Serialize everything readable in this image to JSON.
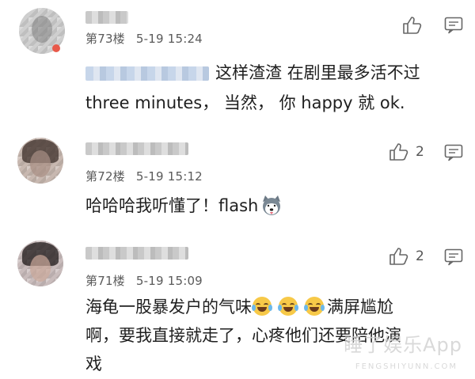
{
  "comments": [
    {
      "floor": "第73楼",
      "time": "5-19 15:24",
      "lines": [
        "这样渣渣 在剧里最多活不过",
        "three minutes， 当然， 你 happy 就 ok."
      ],
      "like_count": ""
    },
    {
      "floor": "第72楼",
      "time": "5-19 15:12",
      "lines": [
        "哈哈哈我听懂了！flash"
      ],
      "like_count": "2"
    },
    {
      "floor": "第71楼",
      "time": "5-19 15:09",
      "lines": [
        "海龟一股暴发户的气味",
        "满屏尴尬",
        "啊，要我直接就走了，心疼他们还要陪他演",
        "戏"
      ],
      "like_count": "2"
    }
  ],
  "watermark": {
    "main": "睡了娱乐App",
    "sub": "FENGSHIYUNN.COM"
  },
  "icons": {
    "like": "thumbs-up-icon",
    "reply": "comment-icon",
    "laugh": "tears-of-joy-emoji",
    "dog": "husky-emoji"
  },
  "colors": {
    "meta_text": "#5a5a5a",
    "body_text": "#1f1f1f",
    "icon": "#666666"
  }
}
